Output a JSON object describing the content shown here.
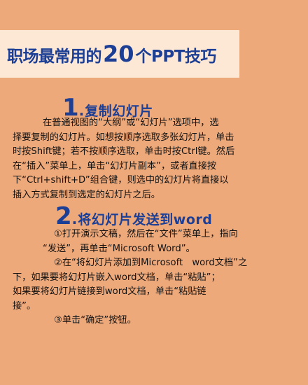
{
  "banner": {
    "title_part1": "职场最常用的",
    "title_number": "20",
    "title_part2": "个PPT技巧"
  },
  "sections": [
    {
      "number": "1",
      "dot": ".",
      "title": "复制幻灯片",
      "lines": [
        "在普通视图的“大纲”或“幻灯片”选项中，选",
        "择要复制的幻灯片。如想按顺序选取多张幻灯片，单击",
        "时按Shift键；若不按顺序选取，单击时按Ctrl键。然后",
        "在“插入”菜单上，单击“幻灯片副本”，或者直接按",
        "下“Ctrl+shift+D”组合键，则选中的幻灯片将直接以",
        "插入方式复制到选定的幻灯片之后。"
      ]
    },
    {
      "number": "2",
      "dot": ".",
      "title": "将幻灯片发送到word",
      "lines": [
        "①打开演示文稿，然后在“文件”菜单上，指向",
        "“发送”，再单击“Microsoft Word”。",
        "②在“将幻灯片添加到Microsoft　word文档”之",
        "下，如果要将幻灯片嵌入word文档，单击“粘贴”；",
        "如果要将幻灯片链接到word文档，单击“粘贴链",
        "接”。",
        "③单击“确定”按钮。"
      ]
    }
  ]
}
